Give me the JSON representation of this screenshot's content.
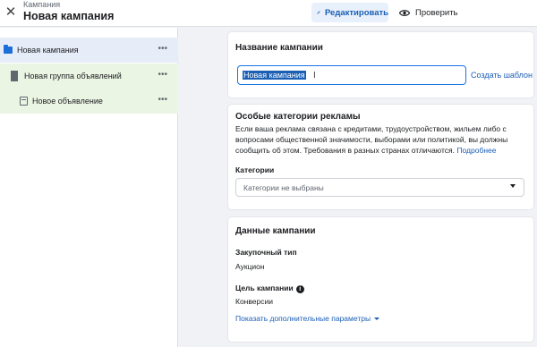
{
  "header": {
    "subtitle": "Кампания",
    "title": "Новая кампания",
    "edit_label": "Редактировать",
    "check_label": "Проверить",
    "close_icon": "close-icon",
    "accent": "#1b5fb6"
  },
  "sidebar": {
    "items": [
      {
        "label": "Новая кампания",
        "icon": "folder-icon",
        "more": "•••",
        "color": "#e7edf8"
      },
      {
        "label": "Новая группа объявлений",
        "icon": "grid-icon",
        "more": "•••",
        "color": "#ebf5e3"
      },
      {
        "label": "Новое объявление",
        "icon": "ad-icon",
        "more": "•••",
        "color": "#ebf5e3"
      }
    ]
  },
  "name_card": {
    "title": "Название кампании",
    "input_value": "Новая кампания",
    "create_template": "Создать шаблон"
  },
  "special_card": {
    "title": "Особые категории рекламы",
    "description": "Если ваша реклама связана с кредитами, трудоустройством, жильем либо с вопросами общественной значимости, выборами или политикой, вы должны сообщить об этом. Требования в разных странах отличаются.",
    "more_link": "Подробнее",
    "categories_label": "Категории",
    "categories_placeholder": "Категории не выбраны"
  },
  "data_card": {
    "title": "Данные кампании",
    "buy_type_label": "Закупочный тип",
    "buy_type_value": "Аукцион",
    "goal_label": "Цель кампании",
    "goal_value": "Конверсии",
    "show_more": "Показать дополнительные параметры"
  }
}
